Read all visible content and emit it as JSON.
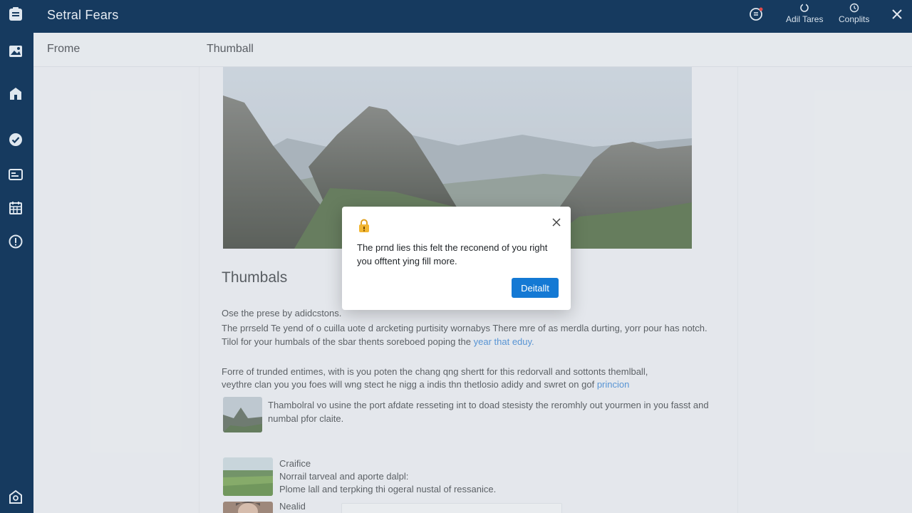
{
  "app": {
    "title": "Setral Fears"
  },
  "topbar": {
    "add_label": "Adil Tares",
    "complete_label": "Conplits"
  },
  "tabs": {
    "home": "Frome",
    "thumbnail": "Thumball"
  },
  "article": {
    "heading": "Thumbals",
    "intro": "Ose the prese by adidcstons.",
    "p1_line1": "The prrseld Te yend of o cuilla uote d arcketing purtisity wornabys There mre of as merdla durting, yorr pour has notch.",
    "p1_line2_pre": "Tilol for your humbals of the sbar thents soreboed poping the ",
    "p1_line2_link": "year that eduy.",
    "p2_line1": "Forre of trunded entimes, with is you poten the chang qng shertt for this redorvall and sottonts themlball,",
    "p2_line2_pre": "veythre clan you you foes will wng stect he nigg a indis thn thetlosio adidy and swret on gof ",
    "p2_line2_link": "princion",
    "item1_line1": "Thambolral vo usine the port afdate resseting int to doad stesisty the reromhly out yourmen in you fasst and",
    "item1_line2": "numbal pfor claite.",
    "item2_title": "Craifice",
    "item2_line1": "Norrail tarveal and aporte dalpl:",
    "item2_line2": "Plome lall and terpking thi ogeral nustal of ressanice.",
    "item3_title": "Nealid"
  },
  "dialog": {
    "message": "The prnd lies this felt the reconend of you right you offtent ying fill more.",
    "button": "Deitallt"
  },
  "colors": {
    "nav_bg": "#163a5f",
    "accent": "#1479d4",
    "link": "#2a7bd0"
  }
}
